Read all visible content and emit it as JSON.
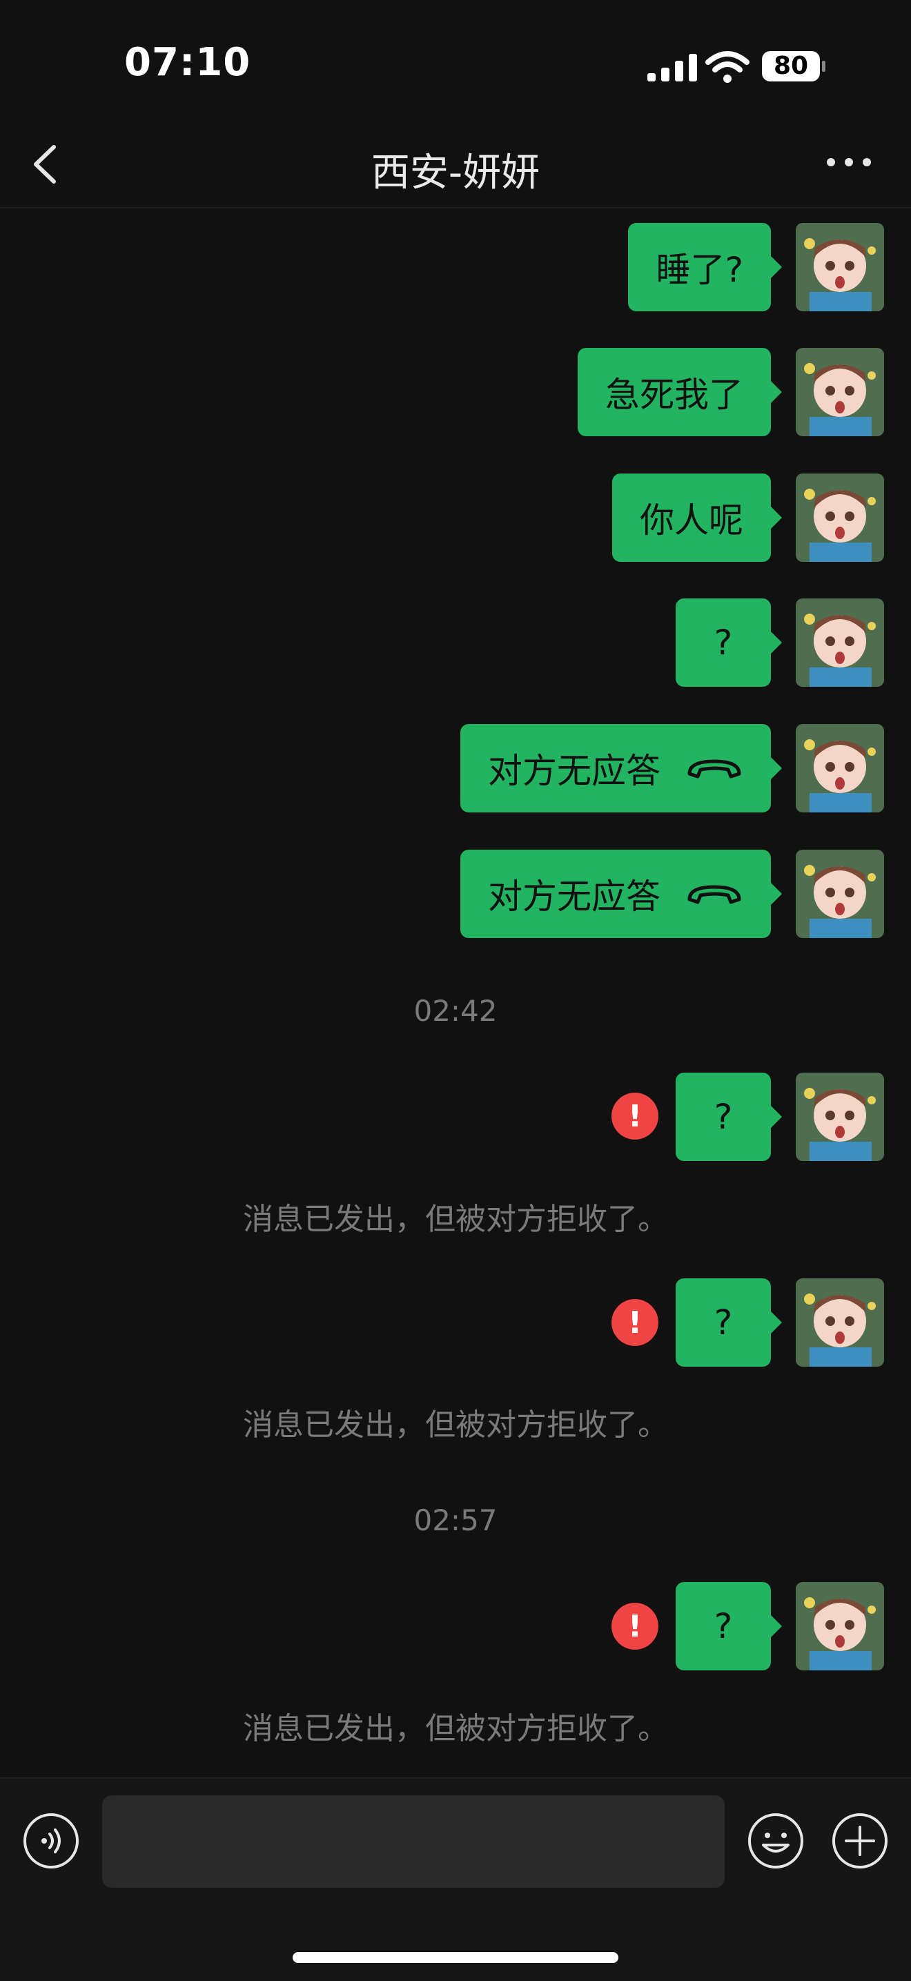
{
  "status_bar": {
    "time": "07:10",
    "battery": "80"
  },
  "nav": {
    "title": "西安-妍妍"
  },
  "messages": [
    {
      "type": "text",
      "text": "睡了?"
    },
    {
      "type": "text",
      "text": "急死我了"
    },
    {
      "type": "text",
      "text": "你人呢"
    },
    {
      "type": "text",
      "text": "?"
    },
    {
      "type": "call",
      "text": "对方无应答",
      "icon": "phone-hangup-icon"
    },
    {
      "type": "call",
      "text": "对方无应答",
      "icon": "phone-hangup-icon"
    },
    {
      "type": "timestamp",
      "text": "02:42"
    },
    {
      "type": "text",
      "text": "?",
      "failed": true
    },
    {
      "type": "system",
      "text": "消息已发出，但被对方拒收了。"
    },
    {
      "type": "text",
      "text": "?",
      "failed": true
    },
    {
      "type": "system",
      "text": "消息已发出，但被对方拒收了。"
    },
    {
      "type": "timestamp",
      "text": "02:57"
    },
    {
      "type": "text",
      "text": "?",
      "failed": true
    },
    {
      "type": "system",
      "text": "消息已发出，但被对方拒收了。"
    }
  ],
  "error_mark": "!",
  "input": {
    "value": "",
    "placeholder": ""
  },
  "colors": {
    "bubble": "#23b462",
    "error": "#f04343",
    "background": "#111111"
  },
  "icons": [
    "back-icon",
    "more-icon",
    "voice-icon",
    "emoji-icon",
    "plus-icon",
    "phone-hangup-icon",
    "error-icon",
    "avatar"
  ]
}
